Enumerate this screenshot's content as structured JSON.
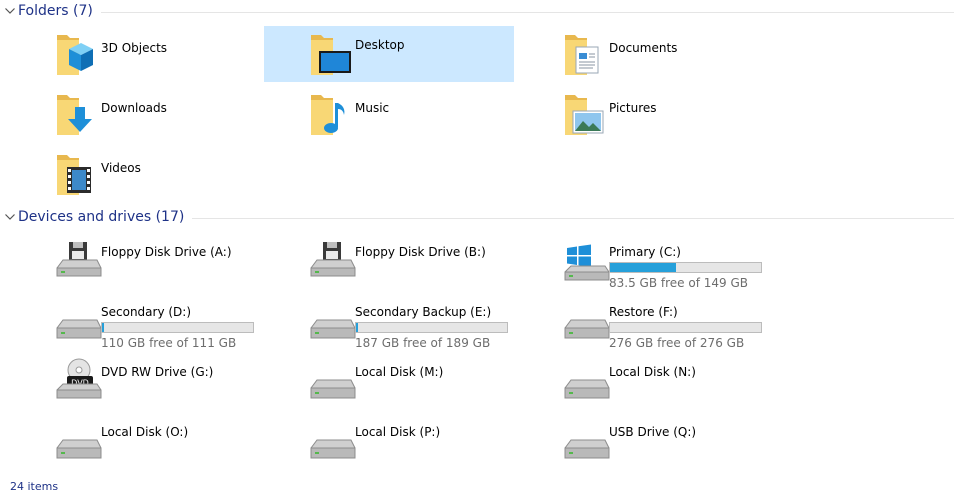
{
  "folders_group": {
    "title": "Folders (7)"
  },
  "folders": [
    {
      "label": "3D Objects",
      "icon": "3d-objects-folder-icon"
    },
    {
      "label": "Desktop",
      "icon": "desktop-folder-icon",
      "selected": true
    },
    {
      "label": "Documents",
      "icon": "documents-folder-icon"
    },
    {
      "label": "Downloads",
      "icon": "downloads-folder-icon"
    },
    {
      "label": "Music",
      "icon": "music-folder-icon"
    },
    {
      "label": "Pictures",
      "icon": "pictures-folder-icon"
    },
    {
      "label": "Videos",
      "icon": "videos-folder-icon"
    }
  ],
  "drives_group": {
    "title": "Devices and drives (17)"
  },
  "drives": [
    {
      "label": "Floppy Disk Drive (A:)",
      "icon": "floppy-drive-icon"
    },
    {
      "label": "Floppy Disk Drive (B:)",
      "icon": "floppy-drive-icon"
    },
    {
      "label": "Primary (C:)",
      "icon": "windows-drive-icon",
      "free_text": "83.5 GB free of 149 GB",
      "used_fraction": 0.44
    },
    {
      "label": "Secondary (D:)",
      "icon": "hard-drive-icon",
      "free_text": "110 GB free of 111 GB",
      "used_fraction": 0.01
    },
    {
      "label": "Secondary Backup (E:)",
      "icon": "hard-drive-icon",
      "free_text": "187 GB free of 189 GB",
      "used_fraction": 0.01
    },
    {
      "label": "Restore (F:)",
      "icon": "hard-drive-icon",
      "free_text": "276 GB free of 276 GB",
      "used_fraction": 0.0
    },
    {
      "label": "DVD RW Drive (G:)",
      "icon": "dvd-drive-icon"
    },
    {
      "label": "Local Disk (M:)",
      "icon": "hard-drive-icon"
    },
    {
      "label": "Local Disk (N:)",
      "icon": "hard-drive-icon"
    },
    {
      "label": "Local Disk (O:)",
      "icon": "hard-drive-icon"
    },
    {
      "label": "Local Disk (P:)",
      "icon": "hard-drive-icon"
    },
    {
      "label": "USB Drive (Q:)",
      "icon": "hard-drive-icon"
    }
  ],
  "status_bar": {
    "item_count": "24 items"
  },
  "colors": {
    "selection": "#cce8ff",
    "group_title": "#1e3287",
    "usage_bar": "#26a0da",
    "folder": "#f8d775"
  }
}
